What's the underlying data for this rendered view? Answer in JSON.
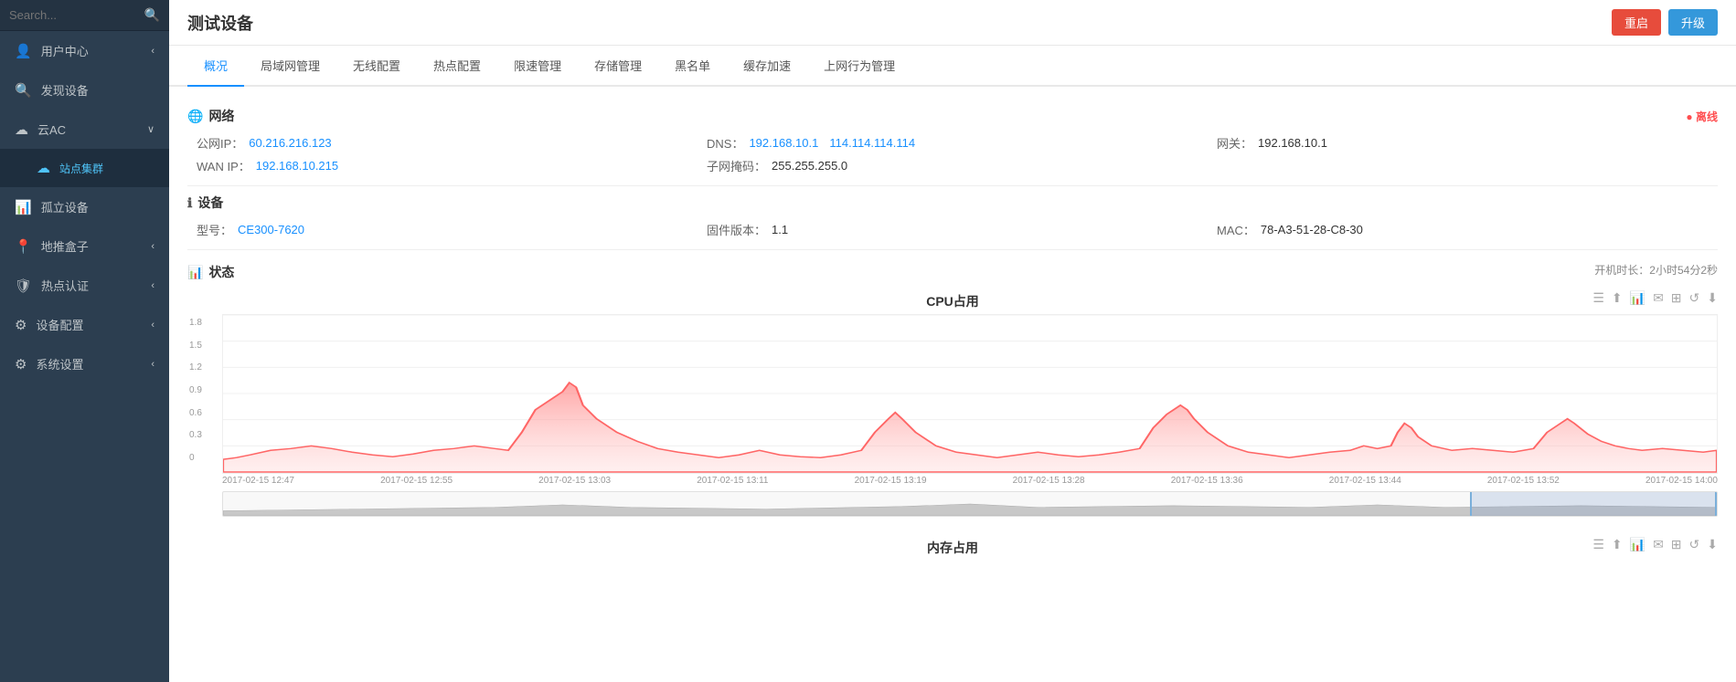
{
  "sidebar": {
    "search_placeholder": "Search...",
    "items": [
      {
        "id": "user-center",
        "label": "用户中心",
        "icon": "👤",
        "arrow": "‹",
        "active": false
      },
      {
        "id": "discover-devices",
        "label": "发现设备",
        "icon": "🔍",
        "arrow": "",
        "active": false
      },
      {
        "id": "cloud-ac",
        "label": "云AC",
        "icon": "☁",
        "arrow": "∨",
        "active": false
      },
      {
        "id": "site-cluster",
        "label": "站点集群",
        "icon": "☁",
        "arrow": "",
        "active": true,
        "sub": true
      },
      {
        "id": "standalone-devices",
        "label": "孤立设备",
        "icon": "📊",
        "arrow": "",
        "active": false,
        "sub": false
      },
      {
        "id": "geo-box",
        "label": "地推盒子",
        "icon": "📍",
        "arrow": "‹",
        "active": false
      },
      {
        "id": "hotspot-auth",
        "label": "热点认证",
        "icon": "🛡",
        "arrow": "‹",
        "active": false
      },
      {
        "id": "device-config",
        "label": "设备配置",
        "icon": "⚙",
        "arrow": "‹",
        "active": false
      },
      {
        "id": "system-settings",
        "label": "系统设置",
        "icon": "⚙",
        "arrow": "‹",
        "active": false
      }
    ]
  },
  "header": {
    "title": "测试设备",
    "btn_restart": "重启",
    "btn_upgrade": "升级"
  },
  "tabs": [
    {
      "id": "overview",
      "label": "概况",
      "active": true
    },
    {
      "id": "lan-mgmt",
      "label": "局域网管理",
      "active": false
    },
    {
      "id": "wireless-config",
      "label": "无线配置",
      "active": false
    },
    {
      "id": "hotspot-config",
      "label": "热点配置",
      "active": false
    },
    {
      "id": "speed-limit",
      "label": "限速管理",
      "active": false
    },
    {
      "id": "storage-mgmt",
      "label": "存储管理",
      "active": false
    },
    {
      "id": "blacklist",
      "label": "黑名单",
      "active": false
    },
    {
      "id": "cache-accel",
      "label": "缓存加速",
      "active": false
    },
    {
      "id": "behavior-mgmt",
      "label": "上网行为管理",
      "active": false
    }
  ],
  "sections": {
    "network": {
      "title": "网络",
      "online_status": "● 离线",
      "public_ip_label": "公网IP：",
      "public_ip_value": "60.216.216.123",
      "wan_ip_label": "WAN IP：",
      "wan_ip_value": "192.168.10.215",
      "dns_label": "DNS：",
      "dns_value1": "192.168.10.1",
      "dns_value2": "114.114.114.114",
      "subnet_mask_label": "子网掩码：",
      "subnet_mask_value": "255.255.255.0",
      "gateway_label": "网关：",
      "gateway_value": "192.168.10.1"
    },
    "device": {
      "title": "设备",
      "model_label": "型号：",
      "model_value": "CE300-7620",
      "firmware_label": "固件版本：",
      "firmware_value": "1.1",
      "mac_label": "MAC：",
      "mac_value": "78-A3-51-28-C8-30"
    },
    "status": {
      "title": "状态",
      "uptime": "开机时长：2小时54分2秒",
      "cpu_title": "CPU占用",
      "memory_title": "内存占用",
      "x_labels": [
        "2017-02-15 12:47",
        "2017-02-15 12:55",
        "2017-02-15 13:03",
        "2017-02-15 13:11",
        "2017-02-15 13:19",
        "2017-02-15 13:28",
        "2017-02-15 13:36",
        "2017-02-15 13:44",
        "2017-02-15 13:52",
        "2017-02-15 14:00"
      ],
      "y_labels": [
        "1.8",
        "1.5",
        "1.2",
        "0.9",
        "0.6",
        "0.3",
        "0"
      ],
      "toolbar_icons": [
        "☰",
        "⬆",
        "📊",
        "✉",
        "⊞",
        "↺",
        "⬇"
      ]
    }
  }
}
